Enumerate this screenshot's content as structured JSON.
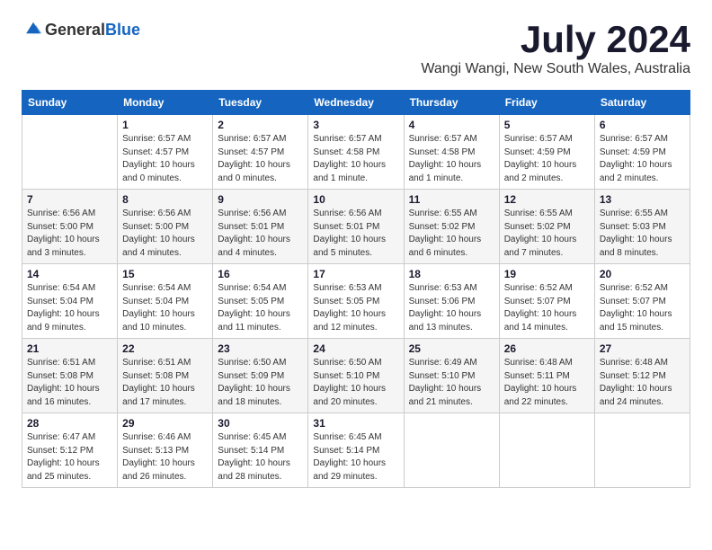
{
  "header": {
    "logo_general": "General",
    "logo_blue": "Blue",
    "month": "July 2024",
    "location": "Wangi Wangi, New South Wales, Australia"
  },
  "weekdays": [
    "Sunday",
    "Monday",
    "Tuesday",
    "Wednesday",
    "Thursday",
    "Friday",
    "Saturday"
  ],
  "weeks": [
    [
      {
        "day": "",
        "sunrise": "",
        "sunset": "",
        "daylight": ""
      },
      {
        "day": "1",
        "sunrise": "Sunrise: 6:57 AM",
        "sunset": "Sunset: 4:57 PM",
        "daylight": "Daylight: 10 hours and 0 minutes."
      },
      {
        "day": "2",
        "sunrise": "Sunrise: 6:57 AM",
        "sunset": "Sunset: 4:57 PM",
        "daylight": "Daylight: 10 hours and 0 minutes."
      },
      {
        "day": "3",
        "sunrise": "Sunrise: 6:57 AM",
        "sunset": "Sunset: 4:58 PM",
        "daylight": "Daylight: 10 hours and 1 minute."
      },
      {
        "day": "4",
        "sunrise": "Sunrise: 6:57 AM",
        "sunset": "Sunset: 4:58 PM",
        "daylight": "Daylight: 10 hours and 1 minute."
      },
      {
        "day": "5",
        "sunrise": "Sunrise: 6:57 AM",
        "sunset": "Sunset: 4:59 PM",
        "daylight": "Daylight: 10 hours and 2 minutes."
      },
      {
        "day": "6",
        "sunrise": "Sunrise: 6:57 AM",
        "sunset": "Sunset: 4:59 PM",
        "daylight": "Daylight: 10 hours and 2 minutes."
      }
    ],
    [
      {
        "day": "7",
        "sunrise": "Sunrise: 6:56 AM",
        "sunset": "Sunset: 5:00 PM",
        "daylight": "Daylight: 10 hours and 3 minutes."
      },
      {
        "day": "8",
        "sunrise": "Sunrise: 6:56 AM",
        "sunset": "Sunset: 5:00 PM",
        "daylight": "Daylight: 10 hours and 4 minutes."
      },
      {
        "day": "9",
        "sunrise": "Sunrise: 6:56 AM",
        "sunset": "Sunset: 5:01 PM",
        "daylight": "Daylight: 10 hours and 4 minutes."
      },
      {
        "day": "10",
        "sunrise": "Sunrise: 6:56 AM",
        "sunset": "Sunset: 5:01 PM",
        "daylight": "Daylight: 10 hours and 5 minutes."
      },
      {
        "day": "11",
        "sunrise": "Sunrise: 6:55 AM",
        "sunset": "Sunset: 5:02 PM",
        "daylight": "Daylight: 10 hours and 6 minutes."
      },
      {
        "day": "12",
        "sunrise": "Sunrise: 6:55 AM",
        "sunset": "Sunset: 5:02 PM",
        "daylight": "Daylight: 10 hours and 7 minutes."
      },
      {
        "day": "13",
        "sunrise": "Sunrise: 6:55 AM",
        "sunset": "Sunset: 5:03 PM",
        "daylight": "Daylight: 10 hours and 8 minutes."
      }
    ],
    [
      {
        "day": "14",
        "sunrise": "Sunrise: 6:54 AM",
        "sunset": "Sunset: 5:04 PM",
        "daylight": "Daylight: 10 hours and 9 minutes."
      },
      {
        "day": "15",
        "sunrise": "Sunrise: 6:54 AM",
        "sunset": "Sunset: 5:04 PM",
        "daylight": "Daylight: 10 hours and 10 minutes."
      },
      {
        "day": "16",
        "sunrise": "Sunrise: 6:54 AM",
        "sunset": "Sunset: 5:05 PM",
        "daylight": "Daylight: 10 hours and 11 minutes."
      },
      {
        "day": "17",
        "sunrise": "Sunrise: 6:53 AM",
        "sunset": "Sunset: 5:05 PM",
        "daylight": "Daylight: 10 hours and 12 minutes."
      },
      {
        "day": "18",
        "sunrise": "Sunrise: 6:53 AM",
        "sunset": "Sunset: 5:06 PM",
        "daylight": "Daylight: 10 hours and 13 minutes."
      },
      {
        "day": "19",
        "sunrise": "Sunrise: 6:52 AM",
        "sunset": "Sunset: 5:07 PM",
        "daylight": "Daylight: 10 hours and 14 minutes."
      },
      {
        "day": "20",
        "sunrise": "Sunrise: 6:52 AM",
        "sunset": "Sunset: 5:07 PM",
        "daylight": "Daylight: 10 hours and 15 minutes."
      }
    ],
    [
      {
        "day": "21",
        "sunrise": "Sunrise: 6:51 AM",
        "sunset": "Sunset: 5:08 PM",
        "daylight": "Daylight: 10 hours and 16 minutes."
      },
      {
        "day": "22",
        "sunrise": "Sunrise: 6:51 AM",
        "sunset": "Sunset: 5:08 PM",
        "daylight": "Daylight: 10 hours and 17 minutes."
      },
      {
        "day": "23",
        "sunrise": "Sunrise: 6:50 AM",
        "sunset": "Sunset: 5:09 PM",
        "daylight": "Daylight: 10 hours and 18 minutes."
      },
      {
        "day": "24",
        "sunrise": "Sunrise: 6:50 AM",
        "sunset": "Sunset: 5:10 PM",
        "daylight": "Daylight: 10 hours and 20 minutes."
      },
      {
        "day": "25",
        "sunrise": "Sunrise: 6:49 AM",
        "sunset": "Sunset: 5:10 PM",
        "daylight": "Daylight: 10 hours and 21 minutes."
      },
      {
        "day": "26",
        "sunrise": "Sunrise: 6:48 AM",
        "sunset": "Sunset: 5:11 PM",
        "daylight": "Daylight: 10 hours and 22 minutes."
      },
      {
        "day": "27",
        "sunrise": "Sunrise: 6:48 AM",
        "sunset": "Sunset: 5:12 PM",
        "daylight": "Daylight: 10 hours and 24 minutes."
      }
    ],
    [
      {
        "day": "28",
        "sunrise": "Sunrise: 6:47 AM",
        "sunset": "Sunset: 5:12 PM",
        "daylight": "Daylight: 10 hours and 25 minutes."
      },
      {
        "day": "29",
        "sunrise": "Sunrise: 6:46 AM",
        "sunset": "Sunset: 5:13 PM",
        "daylight": "Daylight: 10 hours and 26 minutes."
      },
      {
        "day": "30",
        "sunrise": "Sunrise: 6:45 AM",
        "sunset": "Sunset: 5:14 PM",
        "daylight": "Daylight: 10 hours and 28 minutes."
      },
      {
        "day": "31",
        "sunrise": "Sunrise: 6:45 AM",
        "sunset": "Sunset: 5:14 PM",
        "daylight": "Daylight: 10 hours and 29 minutes."
      },
      {
        "day": "",
        "sunrise": "",
        "sunset": "",
        "daylight": ""
      },
      {
        "day": "",
        "sunrise": "",
        "sunset": "",
        "daylight": ""
      },
      {
        "day": "",
        "sunrise": "",
        "sunset": "",
        "daylight": ""
      }
    ]
  ]
}
